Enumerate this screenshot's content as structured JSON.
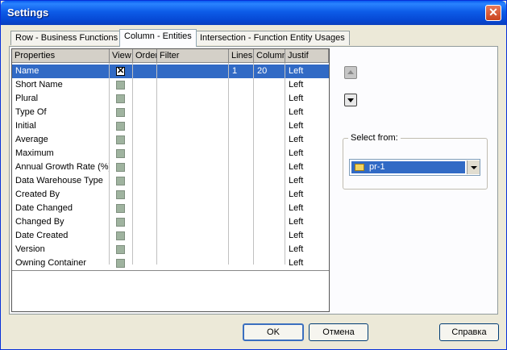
{
  "window": {
    "title": "Settings",
    "close_glyph": "✕"
  },
  "tabs": [
    {
      "label": "Row - Business Functions",
      "active": false
    },
    {
      "label": "Column - Entities",
      "active": true
    },
    {
      "label": "Intersection - Function Entity Usages",
      "active": false
    }
  ],
  "grid": {
    "columns": [
      "Properties",
      "View",
      "Order",
      "Filter",
      "Lines",
      "Column",
      "Justif"
    ],
    "rows": [
      {
        "property": "Name",
        "view": true,
        "order": "",
        "filter": "",
        "lines": "1",
        "column": "20",
        "justify": "Left",
        "selected": true
      },
      {
        "property": "Short Name",
        "view": false,
        "order": "",
        "filter": "",
        "lines": "",
        "column": "",
        "justify": "Left"
      },
      {
        "property": "Plural",
        "view": false,
        "order": "",
        "filter": "",
        "lines": "",
        "column": "",
        "justify": "Left"
      },
      {
        "property": "Type Of",
        "view": false,
        "order": "",
        "filter": "",
        "lines": "",
        "column": "",
        "justify": "Left"
      },
      {
        "property": "Initial",
        "view": false,
        "order": "",
        "filter": "",
        "lines": "",
        "column": "",
        "justify": "Left"
      },
      {
        "property": "Average",
        "view": false,
        "order": "",
        "filter": "",
        "lines": "",
        "column": "",
        "justify": "Left"
      },
      {
        "property": "Maximum",
        "view": false,
        "order": "",
        "filter": "",
        "lines": "",
        "column": "",
        "justify": "Left"
      },
      {
        "property": "Annual Growth Rate (%)",
        "view": false,
        "order": "",
        "filter": "",
        "lines": "",
        "column": "",
        "justify": "Left"
      },
      {
        "property": "Data Warehouse Type",
        "view": false,
        "order": "",
        "filter": "",
        "lines": "",
        "column": "",
        "justify": "Left"
      },
      {
        "property": "Created By",
        "view": false,
        "order": "",
        "filter": "",
        "lines": "",
        "column": "",
        "justify": "Left"
      },
      {
        "property": "Date Changed",
        "view": false,
        "order": "",
        "filter": "",
        "lines": "",
        "column": "",
        "justify": "Left"
      },
      {
        "property": "Changed By",
        "view": false,
        "order": "",
        "filter": "",
        "lines": "",
        "column": "",
        "justify": "Left"
      },
      {
        "property": "Date Created",
        "view": false,
        "order": "",
        "filter": "",
        "lines": "",
        "column": "",
        "justify": "Left"
      },
      {
        "property": "Version",
        "view": false,
        "order": "",
        "filter": "",
        "lines": "",
        "column": "",
        "justify": "Left"
      },
      {
        "property": "Owning Container",
        "view": false,
        "order": "",
        "filter": "",
        "lines": "",
        "column": "",
        "justify": "Left"
      }
    ],
    "check_glyph": "✕"
  },
  "move_up": {
    "icon": "arrow-up-icon",
    "enabled": false
  },
  "move_down": {
    "icon": "arrow-down-icon",
    "enabled": true
  },
  "select_from": {
    "label": "Select from:",
    "value": "pr-1",
    "icon": "folder-icon"
  },
  "buttons": {
    "ok": "OK",
    "cancel": "Отмена",
    "help": "Справка"
  },
  "colors": {
    "titlebar": "#0a5cf0",
    "selection": "#316ac5",
    "dialog_bg": "#ece9d8"
  }
}
